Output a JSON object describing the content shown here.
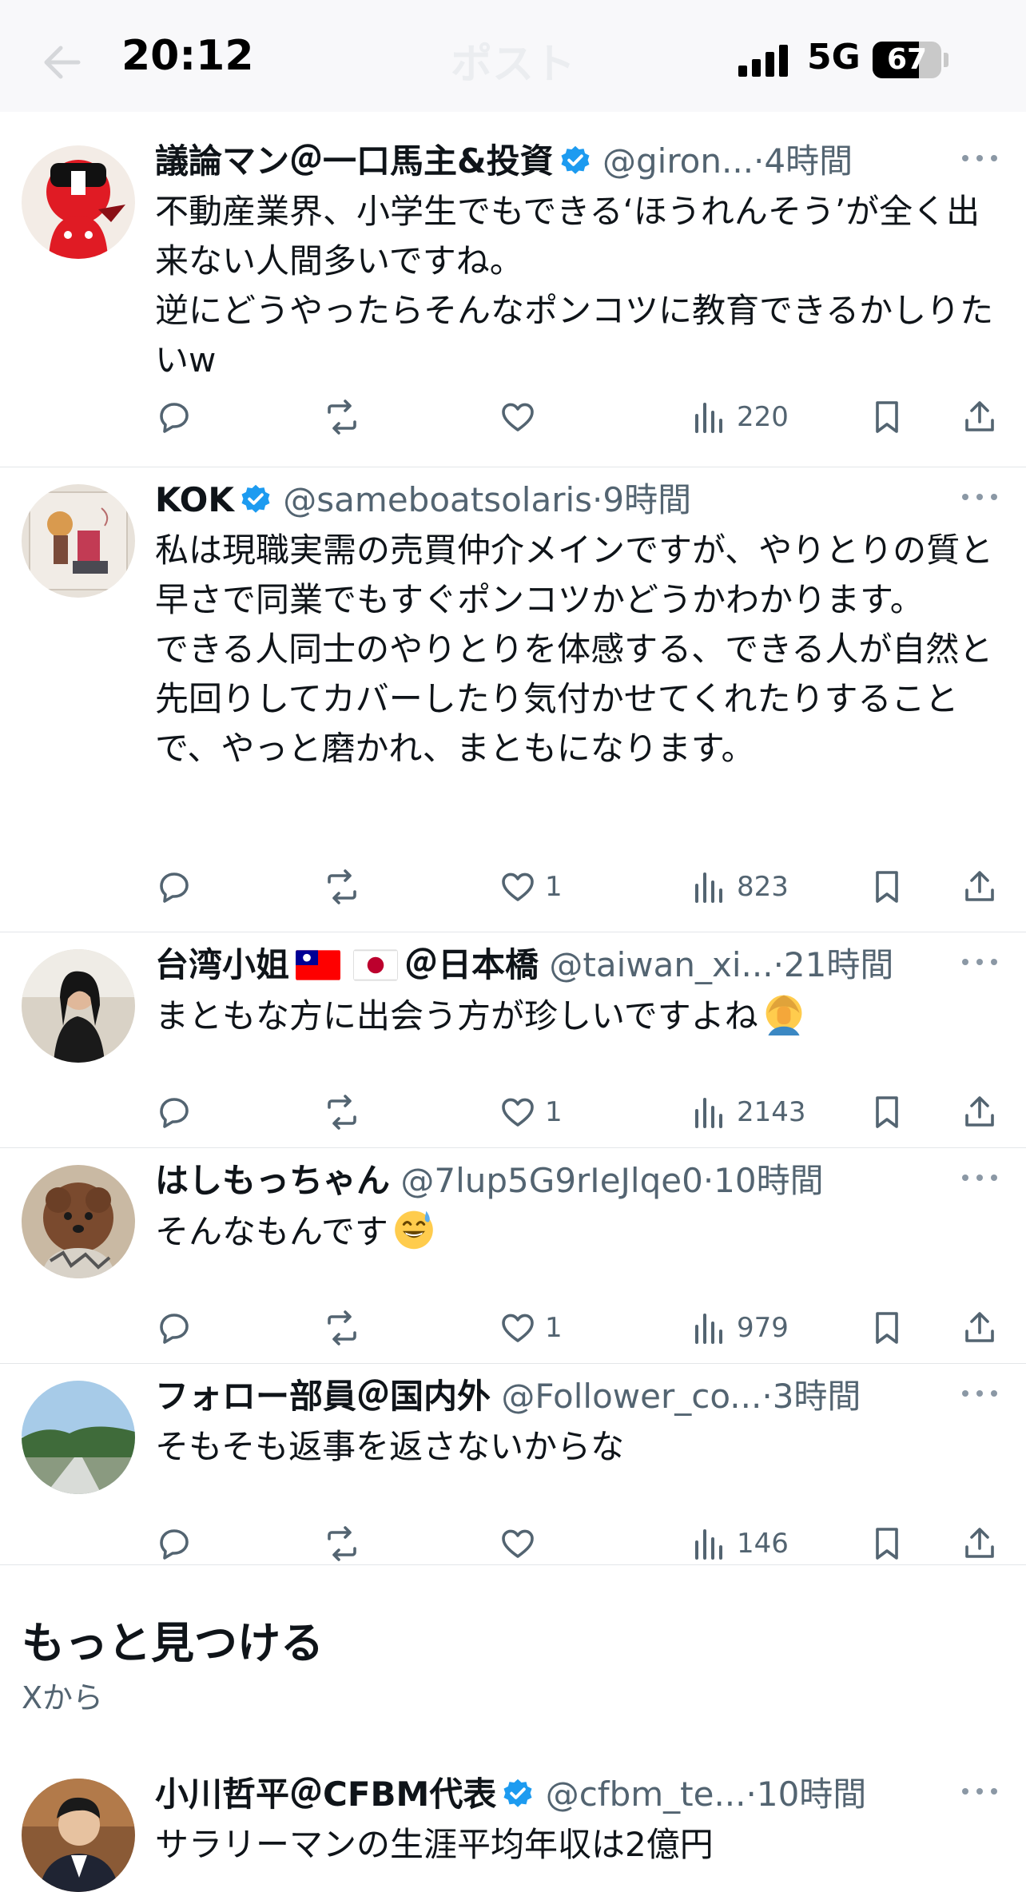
{
  "header": {
    "title": "ポスト"
  },
  "status_bar": {
    "time": "20:12",
    "network": "5G",
    "battery": "67",
    "battery_level": 0.67
  },
  "tweets": [
    {
      "name": "議論マン＠一口馬主&投資",
      "verified": true,
      "handle": "@giron...",
      "age": "4時間",
      "text": "不動産業界、小学生でもできる‘ほうれんそう’が全く出来ない人間多いですね。\n逆にどうやったらそんなポンコツに教育できるかしりたいw",
      "reply_count": "",
      "like_count": "",
      "views": "220"
    },
    {
      "name": "KOK",
      "verified": true,
      "handle": "@sameboatsolaris",
      "age": "9時間",
      "text": "私は現職実需の売買仲介メインですが、やりとりの質と早さで同業でもすぐポンコツかどうかわかります。\nできる人同士のやりとりを体感する、できる人が自然と先回りしてカバーしたり気付かせてくれたりすることで、やっと磨かれ、まともになります。",
      "reply_count": "",
      "like_count": "1",
      "views": "823"
    },
    {
      "name_part1": "台湾小姐",
      "name_part2": "＠日本橋",
      "verified": false,
      "handle": "@taiwan_xi...",
      "age": "21時間",
      "text": "まともな方に出会う方が珍しいですよね",
      "reply_count": "",
      "like_count": "1",
      "views": "2143"
    },
    {
      "name": "はしもっちゃん",
      "verified": false,
      "handle": "@7lup5G9rIeJlqe0",
      "age": "10時間",
      "text": "そんなもんです",
      "reply_count": "",
      "like_count": "1",
      "views": "979"
    },
    {
      "name": "フォロー部員＠国内外",
      "verified": false,
      "handle": "@Follower_co...",
      "age": "3時間",
      "text": "そもそも返事を返さないからな",
      "reply_count": "",
      "like_count": "",
      "views": "146"
    }
  ],
  "discover": {
    "title": "もっと見つける",
    "subtitle": "Xから"
  },
  "suggested_tweet": {
    "name": "小川哲平＠CFBM代表",
    "verified": true,
    "handle": "@cfbm_te...",
    "age": "10時間",
    "text": "サラリーマンの生涯平均年収は2億円"
  },
  "icons": [
    "back-arrow-icon",
    "signal-icon",
    "verified-badge-icon",
    "more-icon",
    "reply-icon",
    "repost-icon",
    "like-icon",
    "views-icon",
    "bookmark-icon",
    "share-icon",
    "facepalm-emoji",
    "sweat-smile-emoji",
    "taiwan-flag",
    "japan-flag"
  ],
  "colors": {
    "verified": "#1d9bf0",
    "text": "#0f1419",
    "secondary": "#536471",
    "divider": "#e3e6e9"
  }
}
